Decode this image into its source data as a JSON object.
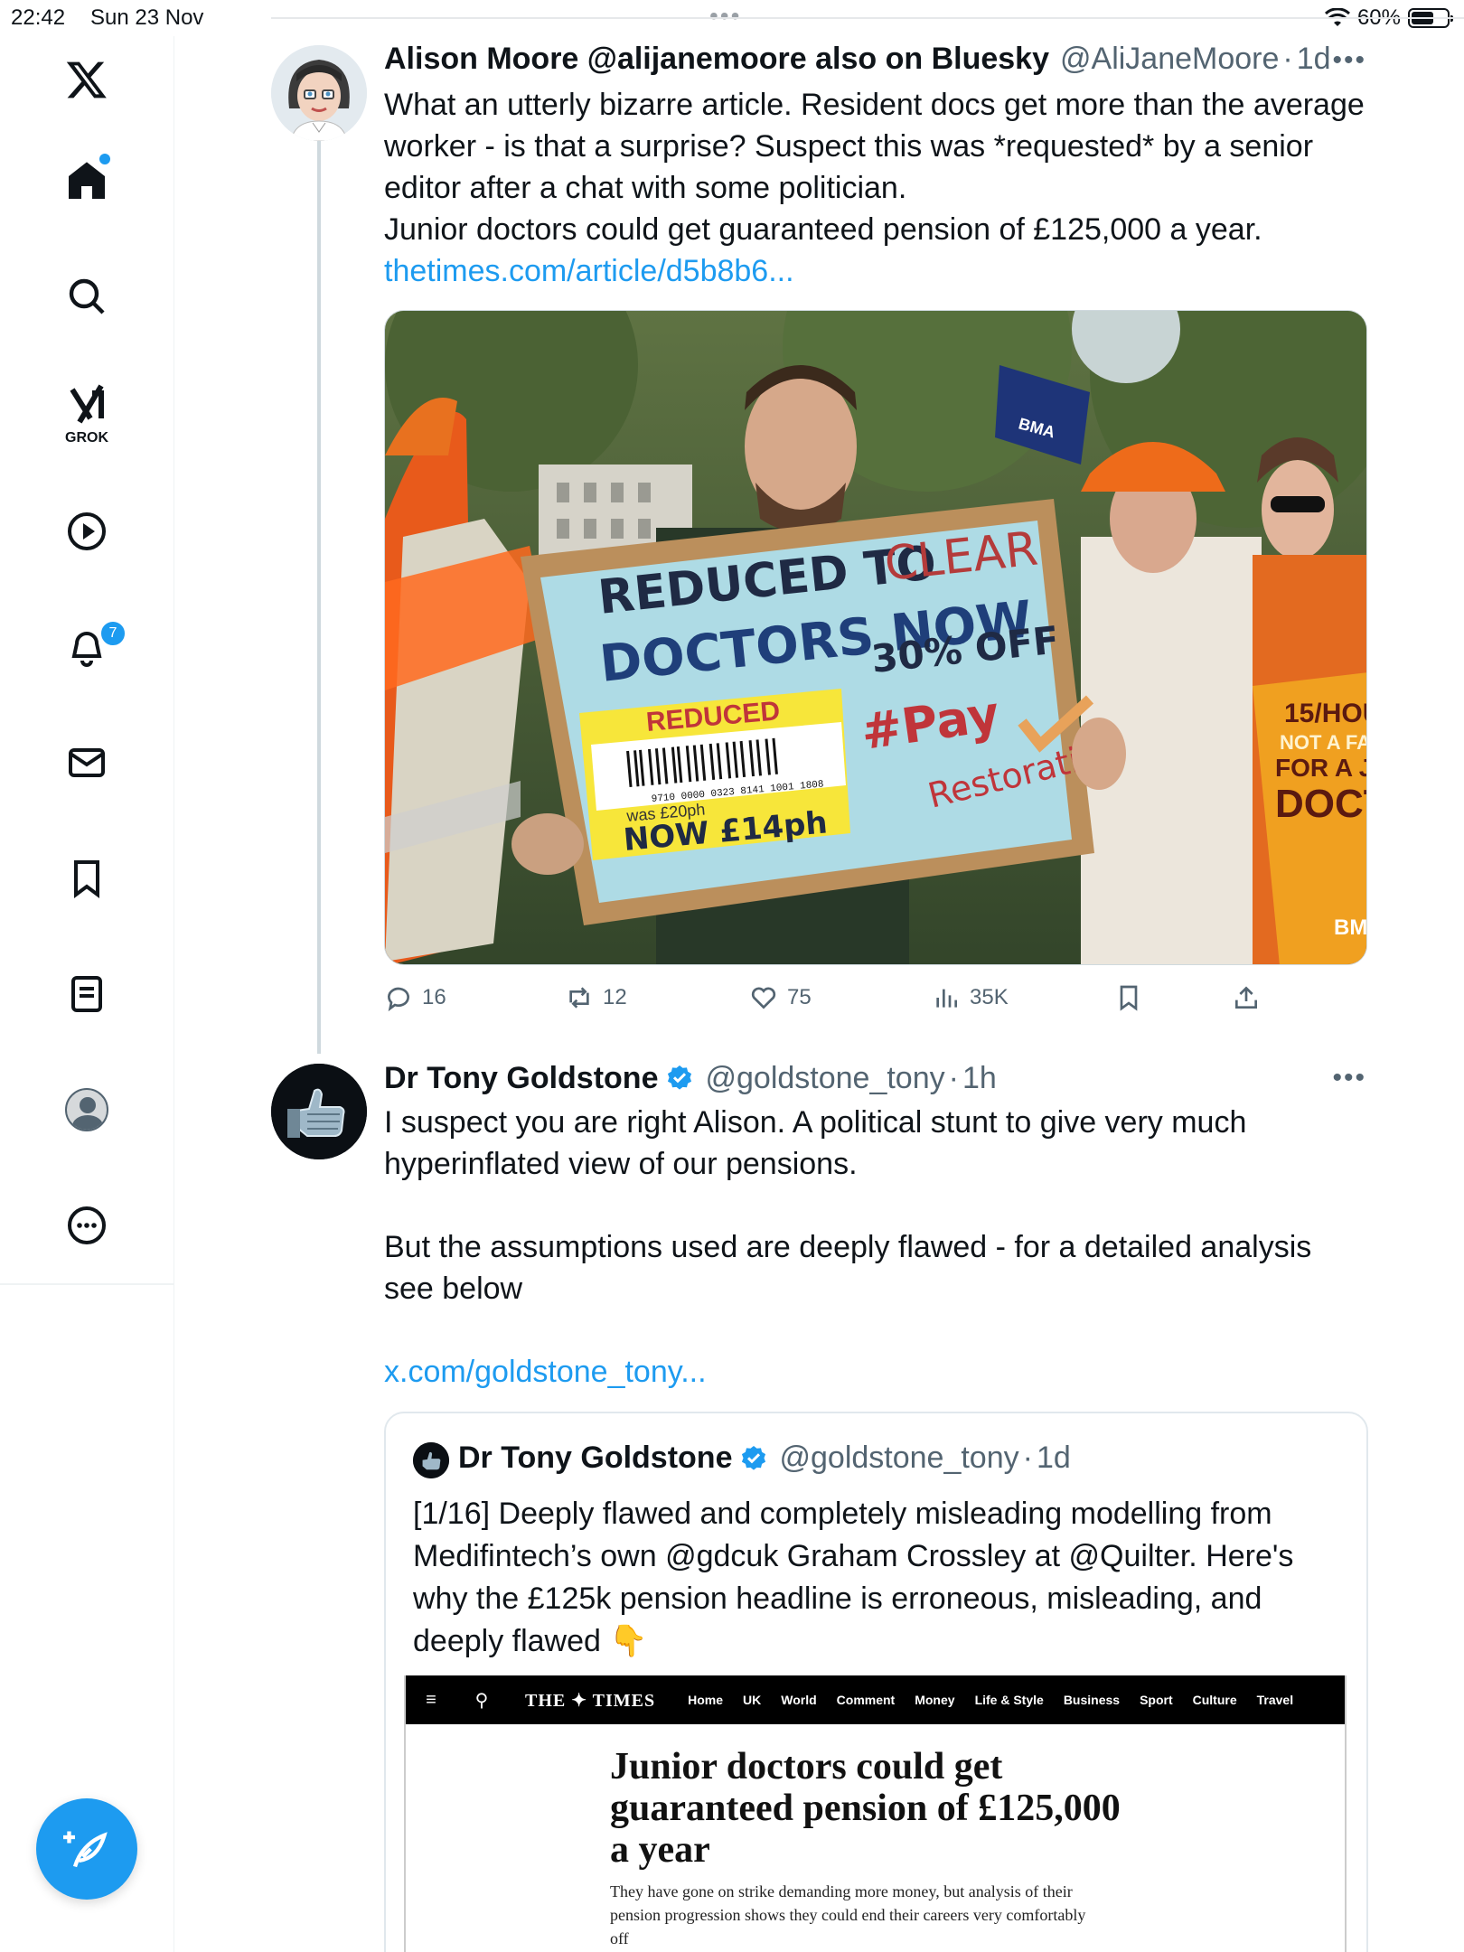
{
  "status": {
    "time": "22:42",
    "date": "Sun 23 Nov",
    "battery": "60%",
    "battery_level": 0.6
  },
  "nav": {
    "grok_label": "GROK",
    "notifications_badge": "7",
    "items": [
      "home",
      "explore",
      "grok",
      "video",
      "notifications",
      "messages",
      "bookmarks",
      "lists",
      "profile",
      "more"
    ]
  },
  "tweets": [
    {
      "name": "Alison Moore @alijanemoore also on Bluesky",
      "handle": "@AliJaneMoore",
      "time": "1d",
      "text_lines": [
        "What an utterly bizarre article. Resident docs get more than the average",
        "worker - is that a surprise? Suspect this was *requested* by a senior",
        "editor after a chat with some politician.",
        "Junior doctors could get guaranteed pension of £125,000 a year."
      ],
      "link": "thetimes.com/article/d5b8b6...",
      "photo": {
        "sign_line1a": "REDUCED TO",
        "sign_line1b": "CLEAR",
        "sign_line2": "DOCTORS NOW",
        "sign_line3": "30% OFF",
        "sign_hashtag1": "#Pay",
        "sign_hashtag2": "Restoration",
        "sticker_label": "REDUCED",
        "sticker_barcode": "9710 0000 0323 8141 1001 1808",
        "sticker_was": "was £20ph",
        "sticker_now": "NOW £14ph",
        "flag_text": "BMA",
        "right_sign_line1": "15/HOU",
        "right_sign_line2": "NOT A FAIR",
        "right_sign_line3": "FOR A JU",
        "right_sign_line4": "DOCT",
        "right_sign_logo": "BM"
      },
      "stats": {
        "replies": "16",
        "reposts": "12",
        "likes": "75",
        "views": "35K"
      }
    },
    {
      "name": "Dr Tony Goldstone",
      "handle": "@goldstone_tony",
      "time": "1h",
      "para1_lines": [
        "I suspect you are right Alison. A political stunt to give very much",
        "hyperinflated view of our pensions."
      ],
      "para2_lines": [
        "But the assumptions used are deeply flawed - for a detailed analysis",
        "see below"
      ],
      "link": "x.com/goldstone_tony...",
      "quote": {
        "name": "Dr Tony Goldstone",
        "handle": "@goldstone_tony",
        "time": "1d",
        "text_lines": [
          "[1/16] Deeply flawed and completely misleading modelling from",
          "Medifintech’s own @gdcuk Graham Crossley at @Quilter. Here's",
          "why the £125k pension headline is erroneous, misleading, and",
          "deeply flawed 👇"
        ],
        "times": {
          "logo": "THE ✦ TIMES",
          "menu": [
            "Home",
            "UK",
            "World",
            "Comment",
            "Money",
            "Life & Style",
            "Business",
            "Sport",
            "Culture",
            "Travel"
          ],
          "headline_lines": [
            "Junior doctors could get",
            "guaranteed pension of £125,000",
            "a year"
          ],
          "sub_lines": [
            "They have gone on strike demanding more money, but analysis of their",
            "pension progression shows they could end their careers very comfortably",
            "off"
          ]
        }
      }
    }
  ],
  "colors": {
    "accent": "#1d9bf0",
    "text": "#0f1419",
    "muted": "#536471",
    "border": "#cfd9de"
  }
}
